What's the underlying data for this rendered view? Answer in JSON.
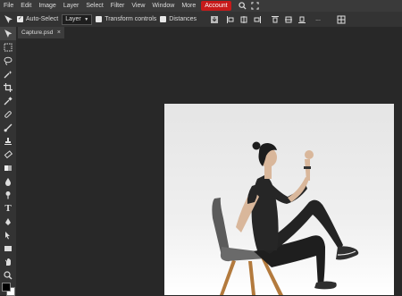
{
  "menubar": {
    "items": [
      "File",
      "Edit",
      "Image",
      "Layer",
      "Select",
      "Filter",
      "View",
      "Window",
      "More"
    ],
    "account_label": "Account",
    "icons": [
      "search-icon",
      "fullscreen-icon"
    ],
    "account_color": "#c71a1a"
  },
  "options": {
    "auto_select_label": "Auto-Select",
    "auto_select_checked": true,
    "target_value": "Layer",
    "transform_label": "Transform controls",
    "distances_label": "Distances",
    "more_label": "..."
  },
  "tab": {
    "title": "Capture.psd",
    "close": "×"
  },
  "tools": [
    "move-tool-icon",
    "marquee-tool-icon",
    "lasso-tool-icon",
    "magic-wand-tool-icon",
    "crop-tool-icon",
    "eyedropper-tool-icon",
    "healing-brush-tool-icon",
    "brush-tool-icon",
    "clone-stamp-tool-icon",
    "eraser-tool-icon",
    "gradient-tool-icon",
    "blur-tool-icon",
    "dodge-tool-icon",
    "type-tool-icon",
    "pen-tool-icon",
    "path-select-tool-icon",
    "rectangle-tool-icon",
    "hand-tool-icon",
    "zoom-tool-icon"
  ],
  "colors": {
    "foreground": "#000000",
    "background": "#ffffff"
  }
}
